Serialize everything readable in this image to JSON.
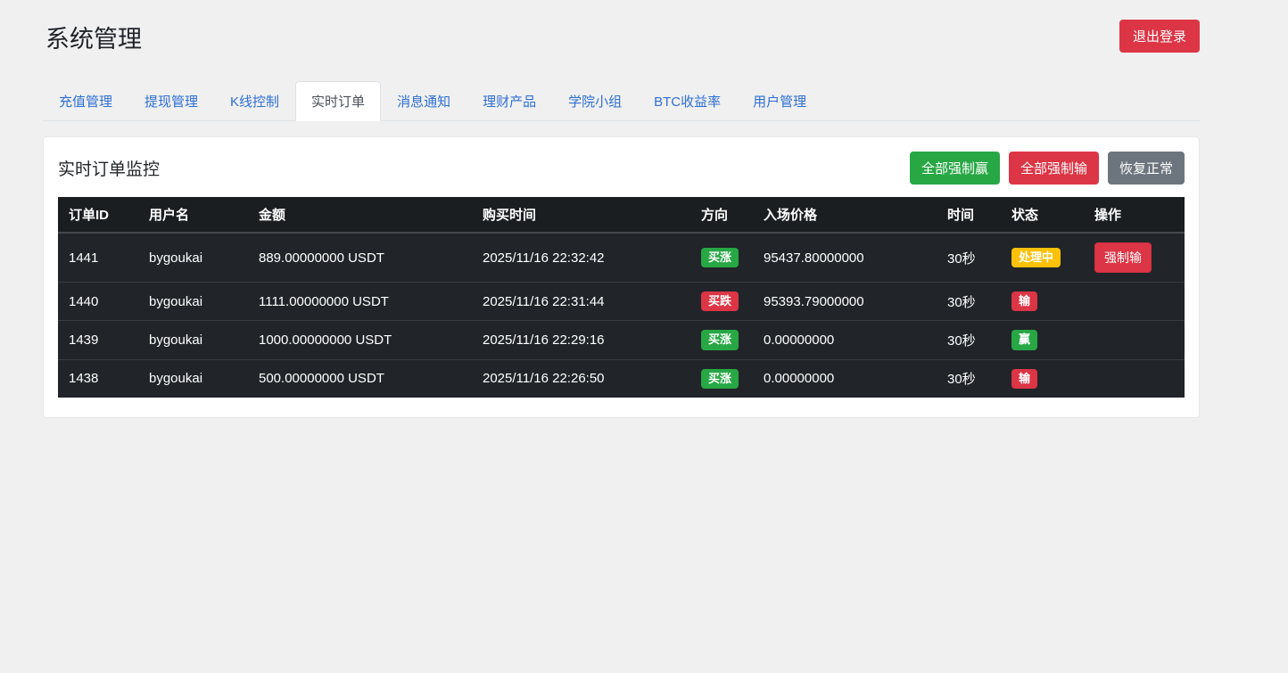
{
  "header": {
    "title": "系统管理",
    "logout_label": "退出登录"
  },
  "tabs": {
    "active_index": 3,
    "items": [
      {
        "label": "充值管理"
      },
      {
        "label": "提现管理"
      },
      {
        "label": "K线控制"
      },
      {
        "label": "实时订单"
      },
      {
        "label": "消息通知"
      },
      {
        "label": "理财产品"
      },
      {
        "label": "学院小组"
      },
      {
        "label": "BTC收益率"
      },
      {
        "label": "用户管理"
      }
    ]
  },
  "panel": {
    "title": "实时订单监控",
    "force_win_all_label": "全部强制赢",
    "force_lose_all_label": "全部强制输",
    "restore_normal_label": "恢复正常"
  },
  "table": {
    "headers": {
      "order_id": "订单ID",
      "username": "用户名",
      "amount": "金额",
      "buy_time": "购买时间",
      "direction": "方向",
      "entry_price": "入场价格",
      "duration": "时间",
      "status": "状态",
      "operation": "操作"
    },
    "rows": [
      {
        "order_id": "1441",
        "username": "bygoukai",
        "amount": "889.00000000 USDT",
        "buy_time": "2025/11/16 22:32:42",
        "direction": "买涨",
        "direction_class": "badge-green",
        "entry_price": "95437.80000000",
        "duration": "30秒",
        "status": "处理中",
        "status_class": "badge-yellow",
        "action": "强制输"
      },
      {
        "order_id": "1440",
        "username": "bygoukai",
        "amount": "1111.00000000 USDT",
        "buy_time": "2025/11/16 22:31:44",
        "direction": "买跌",
        "direction_class": "badge-red",
        "entry_price": "95393.79000000",
        "duration": "30秒",
        "status": "输",
        "status_class": "badge-red",
        "action": ""
      },
      {
        "order_id": "1439",
        "username": "bygoukai",
        "amount": "1000.00000000 USDT",
        "buy_time": "2025/11/16 22:29:16",
        "direction": "买涨",
        "direction_class": "badge-green",
        "entry_price": "0.00000000",
        "duration": "30秒",
        "status": "赢",
        "status_class": "badge-green",
        "action": ""
      },
      {
        "order_id": "1438",
        "username": "bygoukai",
        "amount": "500.00000000 USDT",
        "buy_time": "2025/11/16 22:26:50",
        "direction": "买涨",
        "direction_class": "badge-green",
        "entry_price": "0.00000000",
        "duration": "30秒",
        "status": "输",
        "status_class": "badge-red",
        "action": ""
      }
    ]
  },
  "colors": {
    "success_green": "#28a745",
    "danger_red": "#dc3545",
    "warning_yellow": "#ffc107",
    "secondary_gray": "#6c757d",
    "link_blue": "#2e6fd3",
    "table_dark_bg": "#212529",
    "table_header_bg": "#1b1e21"
  }
}
